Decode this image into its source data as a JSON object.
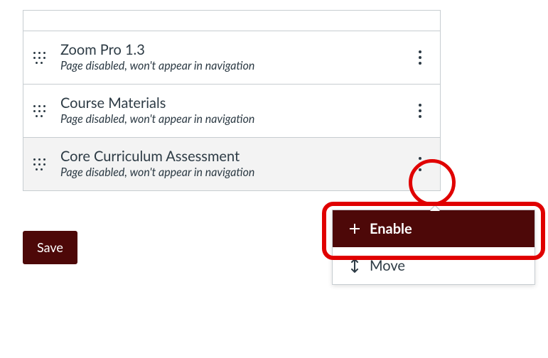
{
  "disabled_note": "Page disabled, won't appear in navigation",
  "rows": [
    {
      "title": "Zoom Pro 1.3"
    },
    {
      "title": "Course Materials"
    },
    {
      "title": "Core Curriculum Assessment"
    }
  ],
  "save_label": "Save",
  "menu": {
    "enable": "Enable",
    "move": "Move"
  }
}
